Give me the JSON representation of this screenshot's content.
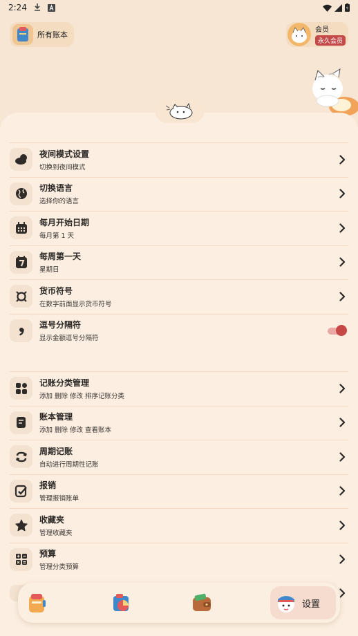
{
  "status_bar": {
    "time": "2:24",
    "icons": [
      "download-icon",
      "text-a-icon",
      "wifi-icon",
      "signal-icon",
      "battery-icon"
    ]
  },
  "header": {
    "account_label": "所有账本",
    "vip_title": "会员",
    "vip_badge": "永久会员"
  },
  "colors": {
    "background": "#f6e6d3",
    "sheet": "#fcefe1",
    "accent": "#c74646"
  },
  "section1": [
    {
      "icon": "cloud-moon-icon",
      "title": "夜间模式设置",
      "sub": "切换到夜间模式",
      "control": "chevron"
    },
    {
      "icon": "globe-icon",
      "title": "切换语言",
      "sub": "选择你的语言",
      "control": "chevron"
    },
    {
      "icon": "calendar-icon",
      "title": "每月开始日期",
      "sub": "每月第 1 天",
      "control": "chevron"
    },
    {
      "icon": "calendar-7-icon",
      "title": "每周第一天",
      "sub": "星期日",
      "control": "chevron"
    },
    {
      "icon": "currency-icon",
      "title": "货币符号",
      "sub": "在数字前面显示货币符号",
      "control": "chevron"
    },
    {
      "icon": "comma-icon",
      "title": "逗号分隔符",
      "sub": "显示金额逗号分隔符",
      "control": "toggle",
      "toggle_on": true
    }
  ],
  "section2": [
    {
      "icon": "category-icon",
      "title": "记账分类管理",
      "sub": "添加 删除 修改 排序记账分类",
      "control": "chevron"
    },
    {
      "icon": "ledger-icon",
      "title": "账本管理",
      "sub": "添加 删除 修改 查看账本",
      "control": "chevron"
    },
    {
      "icon": "repeat-icon",
      "title": "周期记账",
      "sub": "自动进行周期性记账",
      "control": "chevron"
    },
    {
      "icon": "reimburse-icon",
      "title": "报销",
      "sub": "管理报销账单",
      "control": "chevron"
    },
    {
      "icon": "star-icon",
      "title": "收藏夹",
      "sub": "管理收藏夹",
      "control": "chevron"
    },
    {
      "icon": "calculator-icon",
      "title": "预算",
      "sub": "管理分类预算",
      "control": "chevron"
    }
  ],
  "bottom_nav": {
    "items": [
      "ledger-book-icon",
      "chart-book-icon",
      "wallet-icon"
    ],
    "active_label": "设置"
  }
}
